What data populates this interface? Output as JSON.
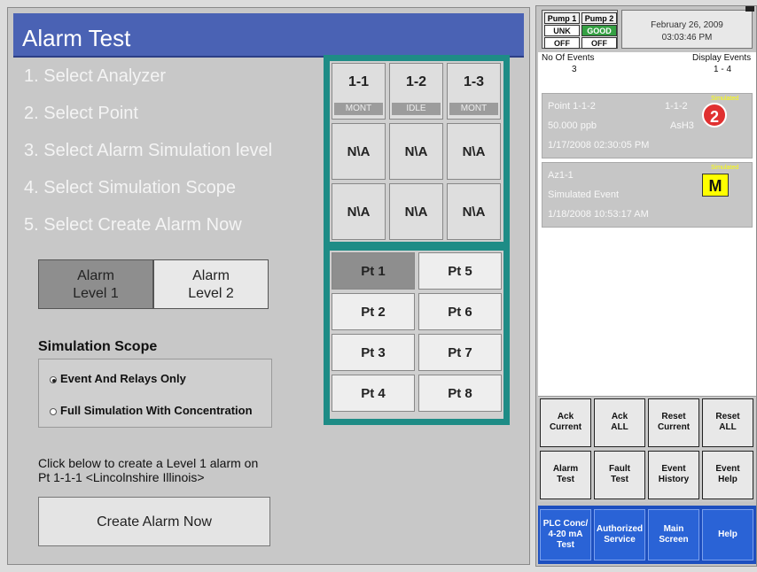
{
  "title": "Alarm Test",
  "steps": [
    "1. Select Analyzer",
    "2. Select Point",
    "3. Select Alarm Simulation level",
    "4. Select Simulation Scope",
    "5. Select Create Alarm Now"
  ],
  "alarm_levels": [
    {
      "line1": "Alarm",
      "line2": "Level 1",
      "selected": true
    },
    {
      "line1": "Alarm",
      "line2": "Level 2",
      "selected": false
    }
  ],
  "scope": {
    "title": "Simulation Scope",
    "options": [
      "Event And Relays Only",
      "Full Simulation With Concentration"
    ],
    "selected_index": 0
  },
  "info_line1": "Click below to create a Level  1 alarm on",
  "info_line2": "Pt 1-1-1 <Lincolnshire Illinois>",
  "create_button": "Create Alarm Now",
  "analyzers": [
    {
      "id": "1-1",
      "status": "MONT"
    },
    {
      "id": "1-2",
      "status": "IDLE"
    },
    {
      "id": "1-3",
      "status": "MONT"
    }
  ],
  "na_label": "N\\A",
  "points": [
    "Pt 1",
    "Pt 5",
    "Pt 2",
    "Pt 6",
    "Pt 3",
    "Pt 7",
    "Pt 4",
    "Pt 8"
  ],
  "selected_point": "Pt 1",
  "pumps": [
    {
      "name": "Pump 1",
      "state": "UNK",
      "power": "OFF"
    },
    {
      "name": "Pump 2",
      "state": "GOOD",
      "power": "OFF"
    }
  ],
  "date": "February 26, 2009",
  "time": "03:03:46 PM",
  "events_header": {
    "count_label": "No Of Events",
    "count": "3",
    "display_label": "Display Events",
    "display_range": "1 - 4"
  },
  "events": [
    {
      "line1": "Point 1-1-2",
      "code": "1-1-2",
      "line2": "50.000  ppb",
      "gas": "AsH3",
      "line3": "1/17/2008 02:30:05 PM",
      "badge": "2",
      "badge_caption": "Simulated"
    },
    {
      "line1": "Az1-1",
      "line2": "Simulated Event",
      "line3": "1/18/2008 10:53:17 AM",
      "badge": "M",
      "badge_caption": "Simulated"
    }
  ],
  "actions": [
    [
      "Ack",
      "Current"
    ],
    [
      "Ack",
      "ALL"
    ],
    [
      "Reset",
      "Current"
    ],
    [
      "Reset",
      "ALL"
    ],
    [
      "Alarm",
      "Test"
    ],
    [
      "Fault",
      "Test"
    ],
    [
      "Event",
      "History"
    ],
    [
      "Event",
      "Help"
    ]
  ],
  "nav": [
    [
      "PLC Conc/",
      "4-20 mA",
      "Test"
    ],
    [
      "Authorized",
      "Service"
    ],
    [
      "Main",
      "Screen"
    ],
    [
      "Help"
    ]
  ],
  "colors": {
    "title_bar": "#4a62b4",
    "grid_frame": "#1e8c86",
    "nav_bar": "#2a63d6",
    "alarm_badge": "#e03030",
    "maint_badge": "#ffff00",
    "pump_good": "#35a043"
  }
}
